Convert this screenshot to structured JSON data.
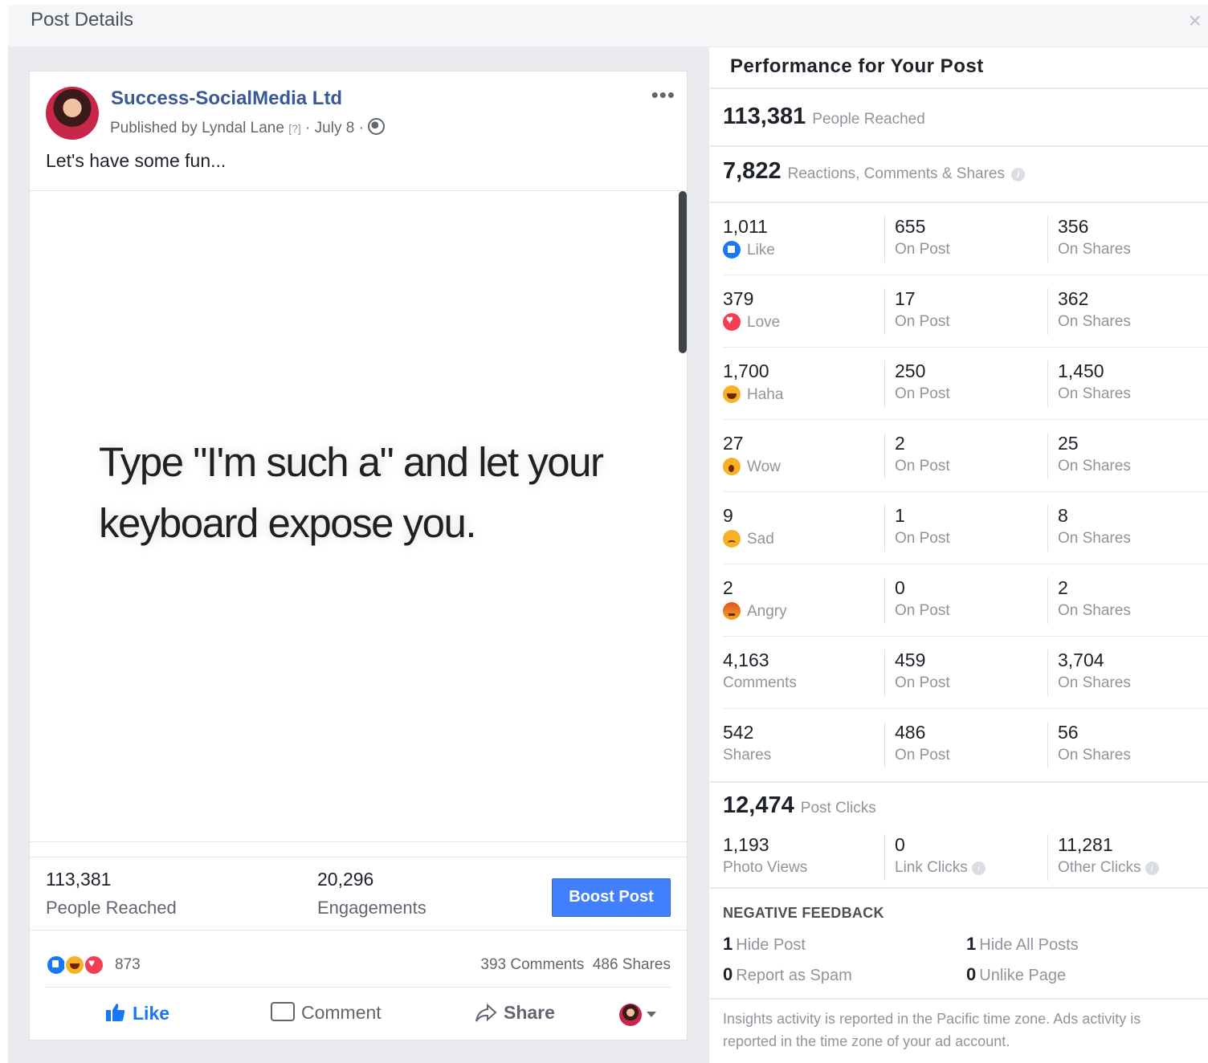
{
  "dialog": {
    "title": "Post Details",
    "close": "×"
  },
  "post": {
    "page_name": "Success-SocialMedia Ltd",
    "published_by": "Published by Lyndal Lane",
    "help_marker": "[?]",
    "date": "July 8",
    "more": "•••",
    "caption": "Let's have some fun...",
    "image_text": "Type \"I'm such a\" and let your keyboard expose you.",
    "reached_value": "113,381",
    "reached_label": "People Reached",
    "engagements_value": "20,296",
    "engagements_label": "Engagements",
    "boost_label": "Boost Post",
    "reaction_count": "873",
    "comments_count": "393 Comments",
    "shares_count": "486 Shares",
    "actions": {
      "like": "Like",
      "comment": "Comment",
      "share": "Share"
    }
  },
  "performance": {
    "title": "Performance for Your Post",
    "reached": {
      "value": "113,381",
      "label": "People Reached"
    },
    "engagement": {
      "value": "7,822",
      "label": "Reactions, Comments & Shares"
    },
    "rows": [
      {
        "total": "1,011",
        "label": "Like",
        "icon": "like-icon",
        "on_post": "655",
        "on_shares": "356"
      },
      {
        "total": "379",
        "label": "Love",
        "icon": "love-icon",
        "on_post": "17",
        "on_shares": "362"
      },
      {
        "total": "1,700",
        "label": "Haha",
        "icon": "haha-icon",
        "on_post": "250",
        "on_shares": "1,450"
      },
      {
        "total": "27",
        "label": "Wow",
        "icon": "wow-icon",
        "on_post": "2",
        "on_shares": "25"
      },
      {
        "total": "9",
        "label": "Sad",
        "icon": "sad-icon",
        "on_post": "1",
        "on_shares": "8"
      },
      {
        "total": "2",
        "label": "Angry",
        "icon": "angry-icon",
        "on_post": "0",
        "on_shares": "2"
      },
      {
        "total": "4,163",
        "label": "Comments",
        "icon": "",
        "on_post": "459",
        "on_shares": "3,704"
      },
      {
        "total": "542",
        "label": "Shares",
        "icon": "",
        "on_post": "486",
        "on_shares": "56"
      }
    ],
    "on_post_label": "On Post",
    "on_shares_label": "On Shares",
    "clicks": {
      "value": "12,474",
      "label": "Post Clicks"
    },
    "click_breakdown": {
      "photo_views": {
        "value": "1,193",
        "label": "Photo Views"
      },
      "link_clicks": {
        "value": "0",
        "label": "Link Clicks"
      },
      "other_clicks": {
        "value": "11,281",
        "label": "Other Clicks"
      }
    },
    "negative_feedback": {
      "title": "NEGATIVE FEEDBACK",
      "hide_post": {
        "value": "1",
        "label": "Hide Post"
      },
      "hide_all": {
        "value": "1",
        "label": "Hide All Posts"
      },
      "report_spam": {
        "value": "0",
        "label": "Report as Spam"
      },
      "unlike_page": {
        "value": "0",
        "label": "Unlike Page"
      }
    },
    "footnote": "Insights activity is reported in the Pacific time zone. Ads activity is reported in the time zone of your ad account."
  },
  "colors": {
    "accent": "#4080ff",
    "link": "#385898",
    "like_blue": "#1877f2",
    "love_red": "#f33e58",
    "emoji_yellow": "#f7b125"
  }
}
